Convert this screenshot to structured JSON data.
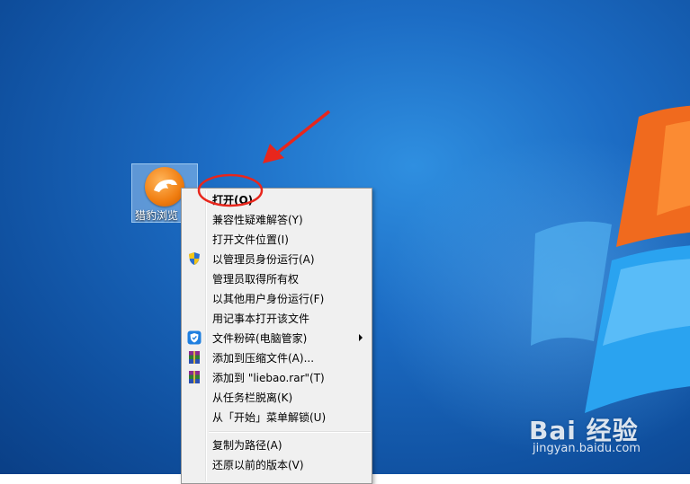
{
  "desktop": {
    "icon_label": "猎豹浏览"
  },
  "context_menu": {
    "items": [
      {
        "label": "打开(O)",
        "icon": ""
      },
      {
        "label": "兼容性疑难解答(Y)",
        "icon": ""
      },
      {
        "label": "打开文件位置(I)",
        "icon": ""
      },
      {
        "label": "以管理员身份运行(A)",
        "icon": "uac-shield-icon"
      },
      {
        "label": "管理员取得所有权",
        "icon": ""
      },
      {
        "label": "以其他用户身份运行(F)",
        "icon": ""
      },
      {
        "label": "用记事本打开该文件",
        "icon": ""
      },
      {
        "label": "文件粉碎(电脑管家)",
        "icon": "tencent-pc-manager-icon"
      },
      {
        "label": "添加到压缩文件(A)...",
        "icon": "winrar-icon"
      },
      {
        "label": "添加到 \"liebao.rar\"(T)",
        "icon": "winrar-icon"
      },
      {
        "label": "从任务栏脱离(K)",
        "icon": ""
      },
      {
        "label": "从「开始」菜单解锁(U)",
        "icon": ""
      },
      {
        "label": "复制为路径(A)",
        "icon": ""
      },
      {
        "label": "还原以前的版本(V)",
        "icon": ""
      }
    ]
  },
  "watermark": {
    "brand": "Bai 经验",
    "url": "jingyan.baidu.com"
  },
  "colors": {
    "annotation_red": "#e8261c",
    "desktop_blue": "#1c6cc4"
  }
}
